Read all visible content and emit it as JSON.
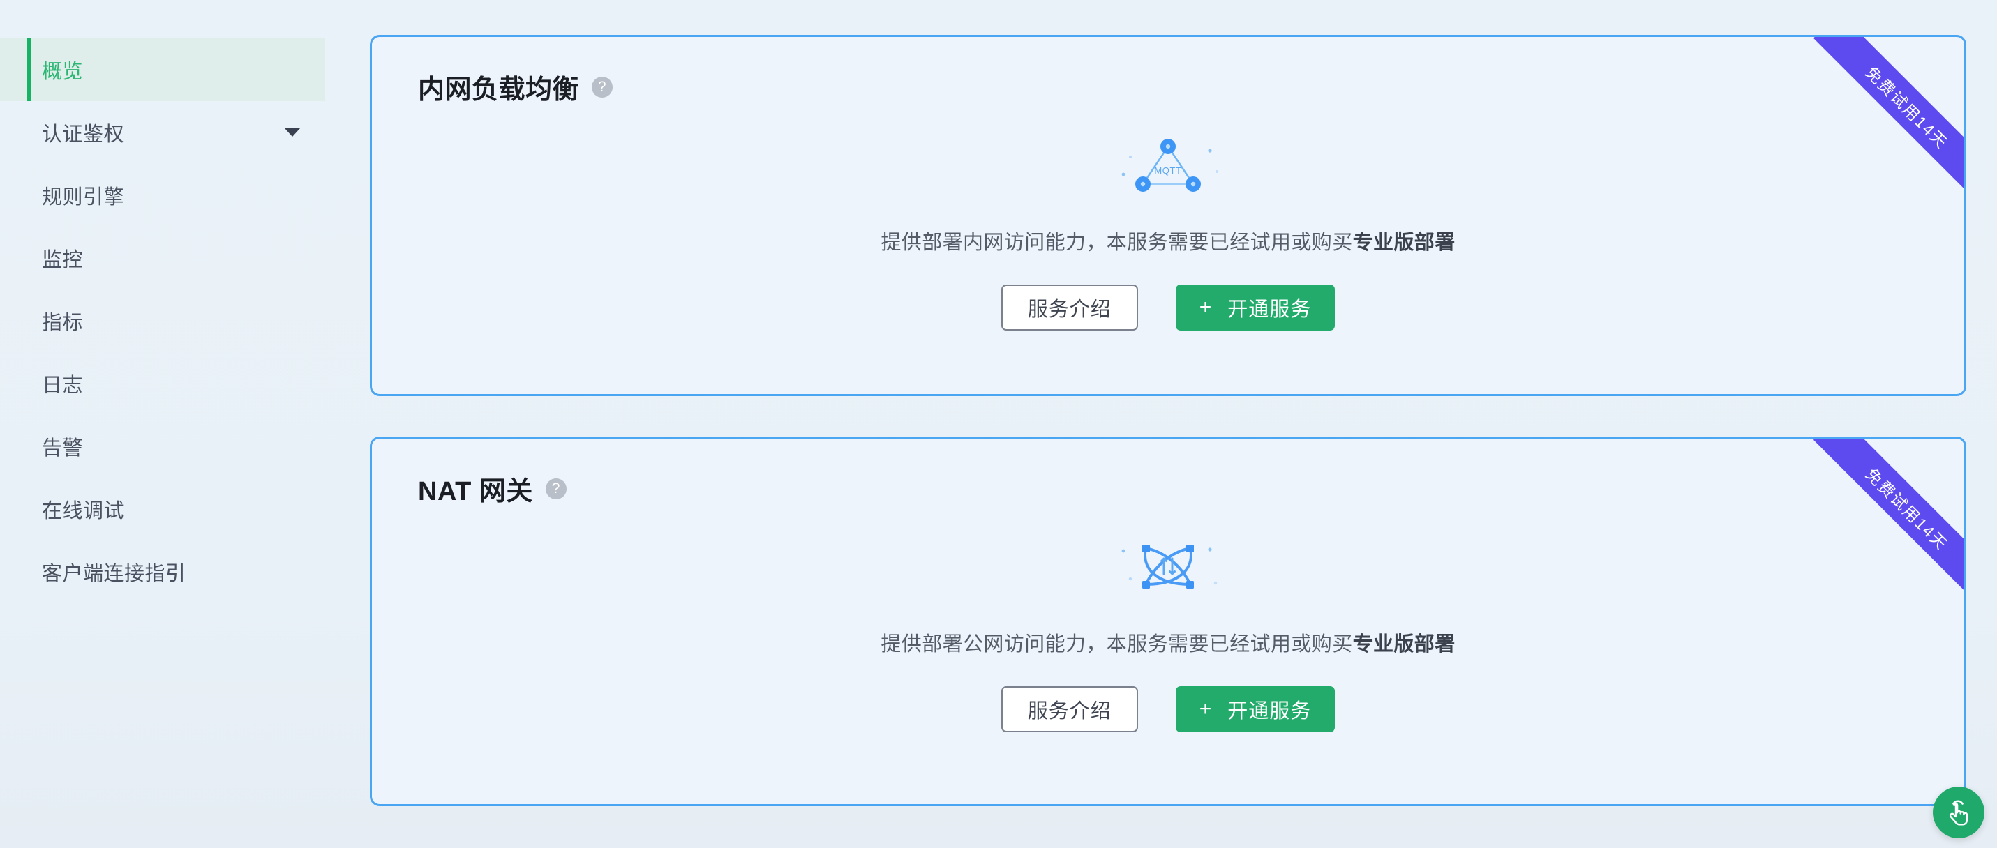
{
  "sidebar": {
    "items": [
      {
        "label": "概览",
        "active": true,
        "has_caret": false
      },
      {
        "label": "认证鉴权",
        "active": false,
        "has_caret": true
      },
      {
        "label": "规则引擎",
        "active": false,
        "has_caret": false
      },
      {
        "label": "监控",
        "active": false,
        "has_caret": false
      },
      {
        "label": "指标",
        "active": false,
        "has_caret": false
      },
      {
        "label": "日志",
        "active": false,
        "has_caret": false
      },
      {
        "label": "告警",
        "active": false,
        "has_caret": false
      },
      {
        "label": "在线调试",
        "active": false,
        "has_caret": false
      },
      {
        "label": "客户端连接指引",
        "active": false,
        "has_caret": false
      }
    ]
  },
  "cards": [
    {
      "title": "内网负载均衡",
      "help_tooltip": "?",
      "illustration": "mqtt-triangle-icon",
      "illustration_label": "MQTT",
      "desc_prefix": "提供部署内网访问能力，本服务需要已经试用或购买",
      "desc_strong": "专业版部署",
      "secondary_button": "服务介绍",
      "primary_button": "开通服务",
      "primary_button_plus": "+",
      "ribbon": "免费试用14天"
    },
    {
      "title": "NAT 网关",
      "help_tooltip": "?",
      "illustration": "nat-gateway-icon",
      "illustration_label": "",
      "desc_prefix": "提供部署公网访问能力，本服务需要已经试用或购买",
      "desc_strong": "专业版部署",
      "secondary_button": "服务介绍",
      "primary_button": "开通服务",
      "primary_button_plus": "+",
      "ribbon": "免费试用14天"
    }
  ],
  "float_button": {
    "icon": "hand-tap-icon"
  },
  "colors": {
    "accent_green": "#22ab6a",
    "active_green": "#16b364",
    "card_border_blue": "#4aa5f2",
    "ribbon_purple": "#5d4bf0",
    "page_background": "#eaf1f8",
    "illustration_blue": "#4a9bf5"
  }
}
